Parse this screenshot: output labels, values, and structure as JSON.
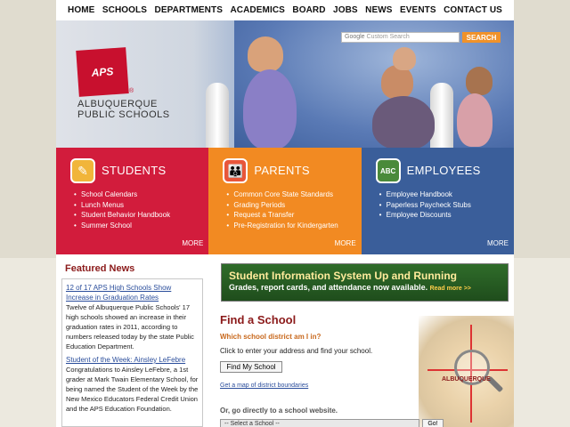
{
  "nav": {
    "items": [
      "HOME",
      "SCHOOLS",
      "DEPARTMENTS",
      "ACADEMICS",
      "BOARD",
      "JOBS",
      "NEWS",
      "EVENTS",
      "CONTACT US"
    ]
  },
  "header": {
    "logo_text": "APS",
    "org_line1": "ALBUQUERQUE",
    "org_line2": "PUBLIC SCHOOLS",
    "search_brand": "Google",
    "search_placeholder": "Custom Search",
    "search_button": "SEARCH"
  },
  "panels": {
    "students": {
      "title": "STUDENTS",
      "items": [
        "School Calendars",
        "Lunch Menus",
        "Student Behavior Handbook",
        "Summer School"
      ],
      "more": "MORE"
    },
    "parents": {
      "title": "PARENTS",
      "items": [
        "Common Core State Standards",
        "Grading Periods",
        "Request a Transfer",
        "Pre-Registration for Kindergarten"
      ],
      "more": "MORE"
    },
    "employees": {
      "title": "EMPLOYEES",
      "items": [
        "Employee Handbook",
        "Paperless Paycheck Stubs",
        "Employee Discounts"
      ],
      "more": "MORE"
    }
  },
  "featured": {
    "title": "Featured News",
    "items": [
      {
        "link": "12 of 17 APS High Schools Show Increase in Graduation Rates",
        "body": "Twelve of Albuquerque Public Schools' 17 high schools showed an increase in their graduation rates in 2011, according to numbers released today by the state Public Education Department."
      },
      {
        "link": "Student of the Week: Ainsley LeFebre",
        "body": "Congratulations to Ainsley LeFebre, a 1st grader at Mark Twain Elementary School, for being named the Student of the Week by the New Mexico Educators Federal Credit Union and the APS Education Foundation."
      }
    ]
  },
  "banner": {
    "line1": "Student Information System Up and Running",
    "line2": "Grades, report cards, and attendance now available.",
    "read_more": "Read more >>"
  },
  "find": {
    "title": "Find a School",
    "subtitle": "Which school district am I in?",
    "text": "Click to enter your address and find your school.",
    "button": "Find My School",
    "map_link": "Get a map of district boundaries",
    "direct": "Or, go directly to a school website.",
    "select": "-- Select a School --",
    "go": "Go!",
    "map_city": "ALBUQUERQUE"
  },
  "colors": {
    "students": "#d21c3c",
    "parents": "#f28a22",
    "employees": "#3a5e9a",
    "accent_orange": "#f0922a",
    "heading_red": "#8b1a1a"
  }
}
